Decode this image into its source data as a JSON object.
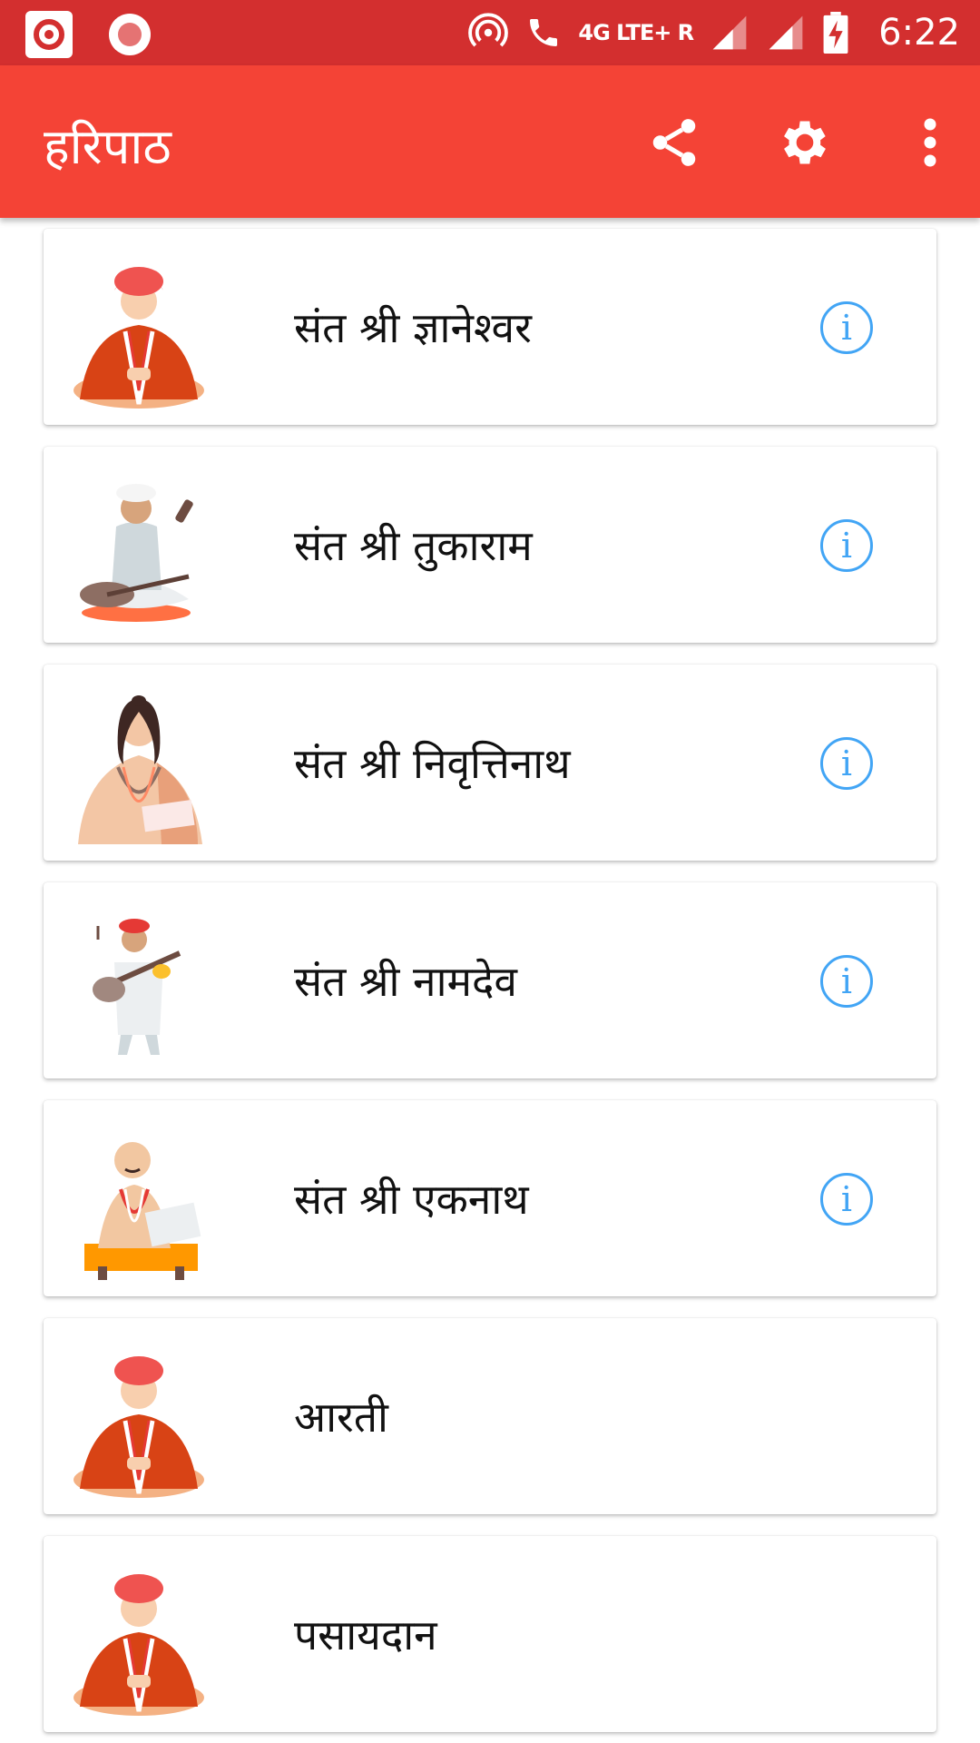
{
  "status_bar": {
    "network": "4G LTE+ R",
    "time": "6:22"
  },
  "app_bar": {
    "title": "हरिपाठ",
    "actions": [
      "share-icon",
      "gear-icon",
      "more-vert-icon"
    ]
  },
  "items": [
    {
      "label": "संत श्री ज्ञानेश्वर",
      "has_info": true,
      "figure": "saint-saffron-turban"
    },
    {
      "label": "संत श्री तुकाराम",
      "has_info": true,
      "figure": "saint-veena-white-turban"
    },
    {
      "label": "संत श्री निवृत्तिनाथ",
      "has_info": true,
      "figure": "saint-long-hair"
    },
    {
      "label": "संत श्री नामदेव",
      "has_info": true,
      "figure": "saint-standing-veena"
    },
    {
      "label": "संत श्री एकनाथ",
      "has_info": true,
      "figure": "saint-writing"
    },
    {
      "label": "आरती",
      "has_info": false,
      "figure": "saint-saffron-turban"
    },
    {
      "label": "पसायदान",
      "has_info": false,
      "figure": "saint-saffron-turban"
    }
  ],
  "info_glyph": "i",
  "colors": {
    "status_bar": "#d32f2f",
    "app_bar": "#f44336",
    "info_accent": "#42a5f5"
  }
}
